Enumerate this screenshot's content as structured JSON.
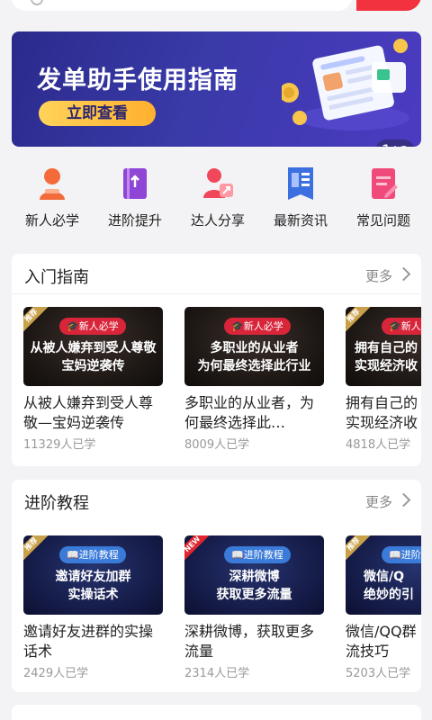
{
  "banner": {
    "title": "发单助手使用指南",
    "button": "立即查看",
    "counter_current": "1",
    "counter_total": "/ 2"
  },
  "quicknav": [
    {
      "label": "新人必学",
      "icon": "person-icon",
      "color": "#f36b3a"
    },
    {
      "label": "进阶提升",
      "icon": "book-icon",
      "color": "#8f45d6"
    },
    {
      "label": "达人分享",
      "icon": "share-person-icon",
      "color": "#f0485a"
    },
    {
      "label": "最新资讯",
      "icon": "news-icon",
      "color": "#3c6fe0"
    },
    {
      "label": "常见问题",
      "icon": "question-doc-icon",
      "color": "#f04a7b"
    }
  ],
  "sections": [
    {
      "title": "入门指南",
      "more": "更多",
      "cards": [
        {
          "ribbon": "推荐",
          "tag": "🎓新人必学",
          "thumb_text": "从被人嫌弃到受人尊敬\n宝妈逆袭传",
          "title": "从被人嫌弃到受人尊敬—宝妈逆袭传",
          "meta": "11329人已学"
        },
        {
          "ribbon": "",
          "tag": "🎓新人必学",
          "thumb_text": "多职业的从业者\n为何最终选择此行业",
          "title": "多职业的从业者，为何最终选择此…",
          "meta": "8009人已学"
        },
        {
          "ribbon": "推荐",
          "tag": "🎓新人必学",
          "thumb_text": "拥有自己的\n实现经济收",
          "title": "拥有自己的\n实现经济收",
          "meta": "4818人已学"
        }
      ]
    },
    {
      "title": "进阶教程",
      "more": "更多",
      "cards": [
        {
          "ribbon": "推荐",
          "tag": "📖进阶教程",
          "thumb_text": "邀请好友加群\n实操话术",
          "title": "邀请好友进群的实操话术",
          "meta": "2429人已学"
        },
        {
          "ribbon": "NEW",
          "tag": "📖进阶教程",
          "thumb_text": "深耕微博\n获取更多流量",
          "title": "深耕微博，获取更多流量",
          "meta": "2314人已学"
        },
        {
          "ribbon": "推荐",
          "tag": "📖进阶",
          "thumb_text": "微信/Q\n绝妙的引",
          "title": "微信/QQ群\n流技巧",
          "meta": "5203人已学"
        }
      ]
    }
  ]
}
